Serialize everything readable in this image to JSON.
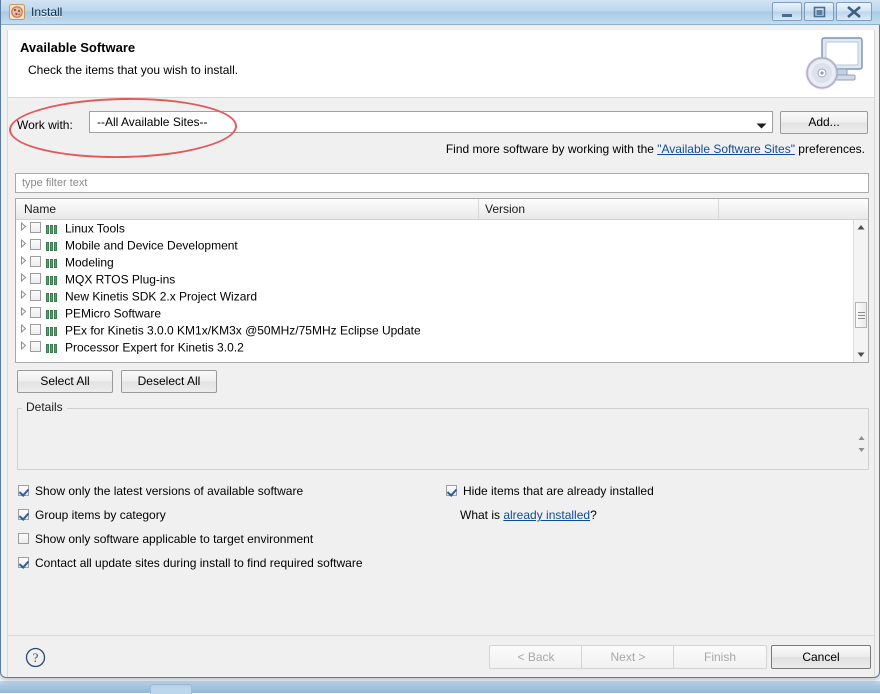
{
  "window": {
    "title": "Install",
    "app_icon": "install-app-icon",
    "controls": {
      "minimize": "minimize-icon",
      "maximize": "maximize-icon",
      "close": "close-icon"
    }
  },
  "header": {
    "title": "Available Software",
    "subtitle": "Check the items that you wish to install.",
    "icon": "install-monitor-cd-icon"
  },
  "work_with": {
    "label": "Work with:",
    "value": "--All Available Sites--",
    "placeholder": "--All Available Sites--",
    "add_button": "Add...",
    "dropdown_icon": "chevron-down-icon"
  },
  "hint": {
    "before": "Find more software by working with the ",
    "link": "\"Available Software Sites\"",
    "after": " preferences."
  },
  "filter": {
    "placeholder": "type filter text",
    "value": ""
  },
  "table": {
    "columns": [
      "Name",
      "Version",
      ""
    ],
    "rows": [
      {
        "name": "Linux Tools",
        "version": "",
        "checked": false,
        "expandable": true
      },
      {
        "name": "Mobile and Device Development",
        "version": "",
        "checked": false,
        "expandable": true
      },
      {
        "name": "Modeling",
        "version": "",
        "checked": false,
        "expandable": true
      },
      {
        "name": "MQX RTOS Plug-ins",
        "version": "",
        "checked": false,
        "expandable": true
      },
      {
        "name": "New Kinetis SDK 2.x Project Wizard",
        "version": "",
        "checked": false,
        "expandable": true
      },
      {
        "name": "PEMicro Software",
        "version": "",
        "checked": false,
        "expandable": true
      },
      {
        "name": "PEx for Kinetis 3.0.0 KM1x/KM3x @50MHz/75MHz Eclipse Update",
        "version": "",
        "checked": false,
        "expandable": true
      },
      {
        "name": "Processor Expert for Kinetis 3.0.2",
        "version": "",
        "checked": false,
        "expandable": true
      }
    ],
    "row_icon": "category-icon",
    "twisty_icon": "expand-arrow-icon",
    "scrollbar": {
      "up_icon": "scroll-up-icon",
      "down_icon": "scroll-down-icon",
      "thumb": "scroll-thumb"
    }
  },
  "buttons": {
    "select_all": "Select All",
    "deselect_all": "Deselect All"
  },
  "details": {
    "legend": "Details",
    "content": ""
  },
  "options": [
    {
      "label": "Show only the latest versions of available software",
      "checked": true
    },
    {
      "label": "Group items by category",
      "checked": true
    },
    {
      "label": "Show only software applicable to target environment",
      "checked": false
    },
    {
      "label": "Contact all update sites during install to find required software",
      "checked": true
    }
  ],
  "options_right": {
    "hide_installed": {
      "label": "Hide items that are already installed",
      "checked": true
    },
    "already_installed": {
      "before": "What is ",
      "link": "already installed",
      "after": "?"
    }
  },
  "wizard_buttons": {
    "back": "< Back",
    "next": "Next >",
    "finish": "Finish",
    "cancel": "Cancel",
    "help_icon": "help-question-icon"
  },
  "annotation": {
    "shape": "ellipse",
    "color": "#e2585b",
    "target": "work-with-row"
  },
  "colors": {
    "link": "#0e4c9b",
    "annotation": "#e2585b",
    "dialog_bg": "#f0f0f0",
    "titlebar": "#bcd6ec"
  }
}
